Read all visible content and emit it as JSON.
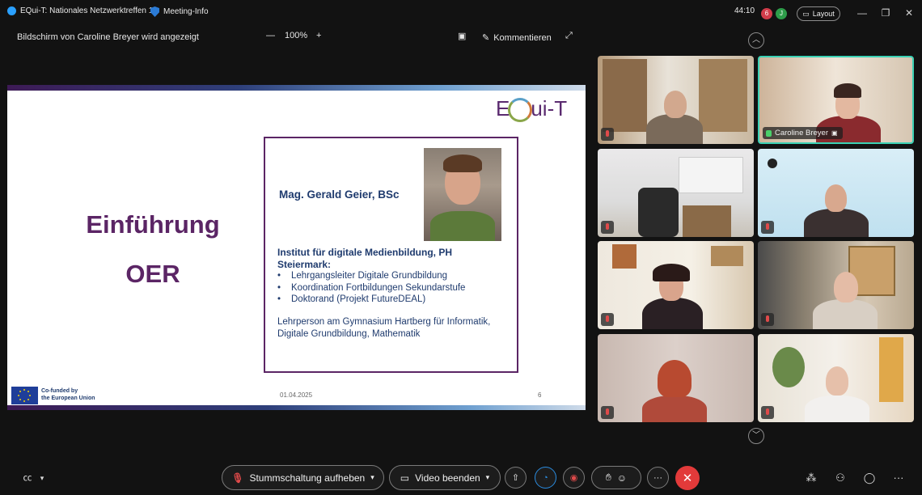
{
  "window": {
    "app_title": "EQui-T: Nationales Netzwerktreffen 1",
    "meeting_info": "Meeting-Info",
    "timer": "44:10",
    "layout_label": "Layout",
    "status_badges": [
      "6",
      "J"
    ]
  },
  "share_bar": {
    "sharing_text": "Bildschirm von Caroline Breyer wird angezeigt",
    "zoom_minus": "—",
    "zoom_level": "100%",
    "zoom_plus": "+",
    "comment_label": "Kommentieren"
  },
  "slide": {
    "logo_text_pre": "E",
    "logo_text_post": "ui-T",
    "heading_1": "Einführung",
    "heading_2": "OER",
    "name": "Mag. Gerald Geier, BSc",
    "institute_1": "Institut für digitale Medienbildung, PH",
    "institute_2": "Steiermark:",
    "bullets": [
      "Lehrgangsleiter Digitale Grundbildung",
      "Koordination Fortbildungen Sekundarstufe",
      "Doktorand (Projekt FutureDEAL)"
    ],
    "teacher_1": "Lehrperson am Gymnasium Hartberg für Informatik,",
    "teacher_2": "Digitale Grundbildung, Mathematik",
    "eu_line_1": "Co-funded by",
    "eu_line_2": "the European Union",
    "date": "01.04.2025",
    "page_number": "6"
  },
  "participants": [
    {
      "name": "",
      "muted": true
    },
    {
      "name": "Caroline Breyer",
      "muted": false,
      "active": true
    },
    {
      "name": "",
      "muted": true
    },
    {
      "name": "",
      "muted": true
    },
    {
      "name": "",
      "muted": true
    },
    {
      "name": "",
      "muted": true
    },
    {
      "name": "",
      "muted": true
    },
    {
      "name": "",
      "muted": true
    }
  ],
  "toolbar": {
    "unmute_label": "Stummschaltung aufheben",
    "video_label": "Video beenden",
    "more_label": "···"
  },
  "colors": {
    "accent_active": "#3bd1b4",
    "end_call": "#e23a3a",
    "slide_heading": "#5b2565",
    "slide_text": "#1f3b6e"
  }
}
